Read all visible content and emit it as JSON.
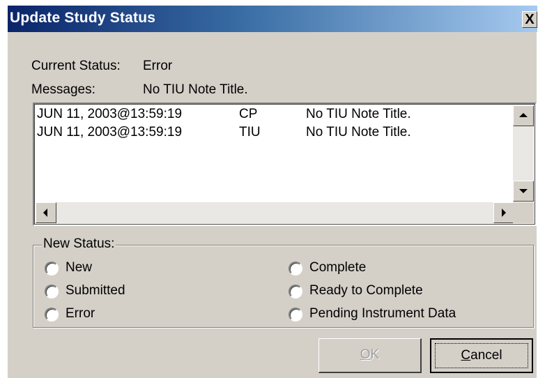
{
  "window": {
    "title": "Update Study Status",
    "close_glyph": "X",
    "titlebar_colors": [
      "#0a246a",
      "#a6caf0"
    ],
    "face_color": "#d4d0c8"
  },
  "current_status": {
    "label": "Current Status:",
    "value": "Error"
  },
  "messages": {
    "label": "Messages:",
    "value": "No TIU Note Title."
  },
  "message_list": {
    "rows": [
      {
        "timestamp": "JUN 11, 2003@13:59:19",
        "source": "CP",
        "message": "No TIU Note Title."
      },
      {
        "timestamp": "JUN 11, 2003@13:59:19",
        "source": "TIU",
        "message": "No TIU Note Title."
      }
    ]
  },
  "new_status": {
    "legend": "New Status:",
    "options": [
      {
        "label": "New",
        "selected": false
      },
      {
        "label": "Submitted",
        "selected": false
      },
      {
        "label": "Error",
        "selected": false
      },
      {
        "label": "Complete",
        "selected": false
      },
      {
        "label": "Ready to Complete",
        "selected": false
      },
      {
        "label": "Pending Instrument Data",
        "selected": false
      }
    ]
  },
  "buttons": {
    "ok": {
      "mnemonic": "O",
      "rest": "K",
      "enabled": false
    },
    "cancel": {
      "mnemonic": "C",
      "rest": "ancel",
      "enabled": true
    }
  },
  "icons": [
    "close-icon",
    "scroll-up-arrow-icon",
    "scroll-down-arrow-icon",
    "scroll-left-arrow-icon",
    "scroll-right-arrow-icon"
  ]
}
